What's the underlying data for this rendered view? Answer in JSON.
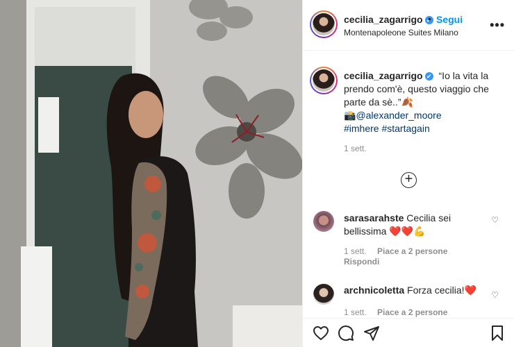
{
  "post": {
    "username": "cecilia_zagarrigo",
    "verified_badge": "✔",
    "dot": "•",
    "follow_label": "Segui",
    "location": "Montenapoleone Suites Milano",
    "more_label": "•••"
  },
  "caption": {
    "username": "cecilia_zagarrigo",
    "text": "“Io la vita la prendo com'è, questo viaggio che parte da sè..”🍂",
    "camera_emoji": "📸",
    "mention": "@alexander_moore",
    "hashtags": "#imhere #startagain",
    "time": "1 sett.",
    "load_more_icon": "+"
  },
  "comments": [
    {
      "username": "sarasarahste",
      "text": "Cecilia sei bellissima ❤️❤️💪",
      "time": "1 sett.",
      "likes": "Piace a 2 persone",
      "reply": "Rispondi"
    },
    {
      "username": "archnicoletta",
      "text": "Forza cecilia!❤️",
      "time": "1 sett.",
      "likes": "Piace a 2 persone"
    }
  ],
  "icons": {
    "heart": "heart-icon",
    "comment": "comment-icon",
    "share": "paper-plane-icon",
    "save": "bookmark-icon",
    "more": "more-icon",
    "small_heart": "♡"
  },
  "colors": {
    "follow_blue": "#0095f6",
    "verified_blue": "#3897f0",
    "link_blue": "#00376b",
    "muted_gray": "#8e8e8e"
  }
}
